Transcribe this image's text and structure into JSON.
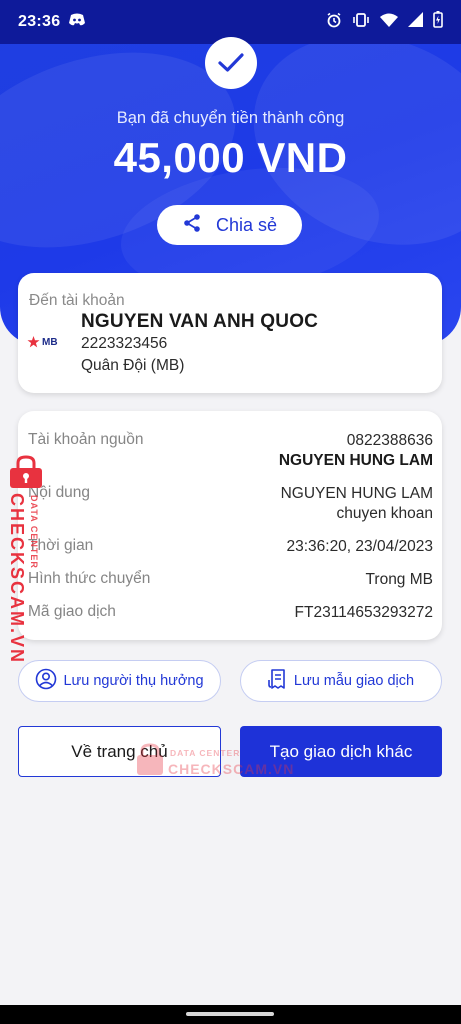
{
  "statusbar": {
    "time": "23:36",
    "icons": [
      "discord-icon",
      "alarm-icon",
      "vibrate-icon",
      "wifi-icon",
      "signal-icon",
      "battery-charging-icon"
    ]
  },
  "header": {
    "success_message": "Bạn đã chuyển tiền thành công",
    "amount": "45,000 VND",
    "share_label": "Chia sẻ",
    "background_color": "#1f3fe0"
  },
  "destination": {
    "label": "Đến tài khoản",
    "bank_logo_text": "MB",
    "name": "NGUYEN VAN ANH QUOC",
    "account_number": "2223323456",
    "bank_name": "Quân Đội (MB)"
  },
  "details": [
    {
      "key": "Tài khoản nguồn",
      "value": "0822388636",
      "value2": "NGUYEN HUNG LAM"
    },
    {
      "key": "Nội dung",
      "value": "NGUYEN HUNG LAM",
      "value2": "chuyen khoan"
    },
    {
      "key": "Thời gian",
      "value": "23:36:20, 23/04/2023"
    },
    {
      "key": "Hình thức chuyển",
      "value": "Trong MB"
    },
    {
      "key": "Mã giao dịch",
      "value": "FT23114653293272"
    }
  ],
  "actions": {
    "save_recipient": "Lưu người thụ hưởng",
    "save_template": "Lưu mẫu giao dịch",
    "home": "Về trang chủ",
    "new_transaction": "Tạo giao dịch khác"
  },
  "watermark": {
    "brand": "CHECKSCAM.VN",
    "sub": "DATA CENTER"
  },
  "colors": {
    "primary": "#1e32d8",
    "watermark": "#e8323f"
  }
}
